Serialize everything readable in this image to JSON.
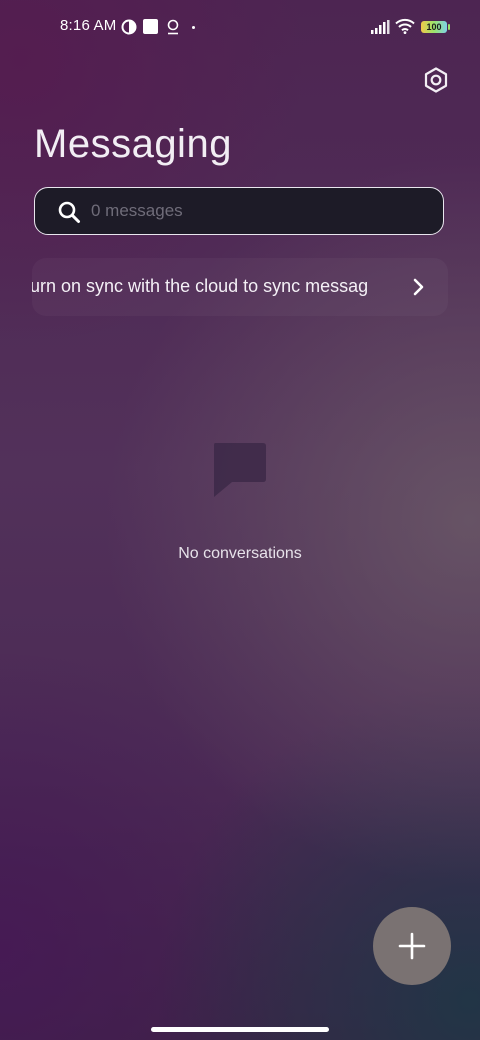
{
  "status_bar": {
    "time": "8:16 AM",
    "battery_level": "100"
  },
  "header": {
    "title": "Messaging"
  },
  "search": {
    "placeholder": "0 messages"
  },
  "sync_banner": {
    "text": "urn on sync with the cloud to sync messag"
  },
  "empty_state": {
    "text": "No conversations"
  },
  "colors": {
    "search_border": "#e9e6ee",
    "search_bg": "#1d1b27",
    "fab_bg": "#7a7272"
  },
  "icons": [
    "gear-icon",
    "search-icon",
    "chevron-right-icon",
    "chat-bubble-icon",
    "plus-icon",
    "wifi-icon",
    "signal-icon",
    "battery-icon"
  ]
}
